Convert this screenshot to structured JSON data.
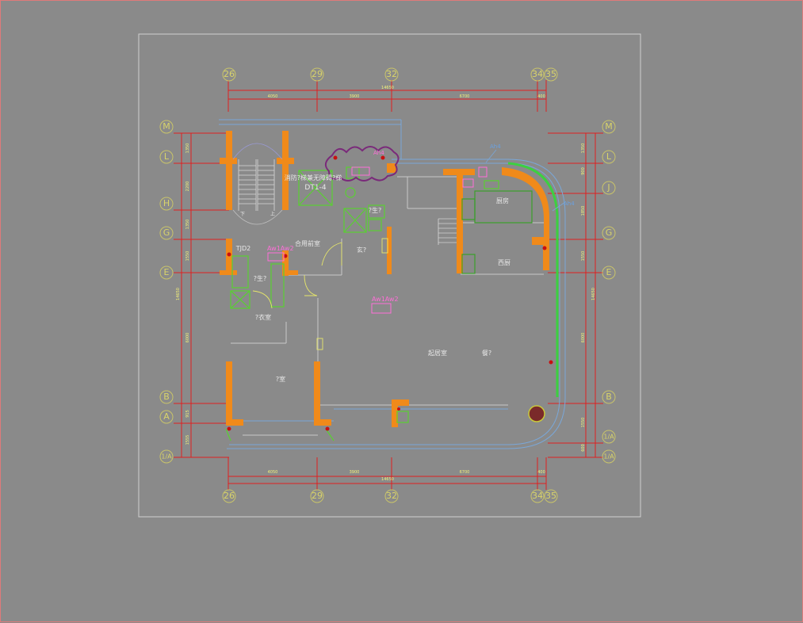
{
  "grid": {
    "columns": [
      "26",
      "29",
      "32",
      "34",
      "35"
    ],
    "rows_left": [
      "M",
      "L",
      "H",
      "G",
      "E",
      "B",
      "A",
      "1/A"
    ],
    "rows_right": [
      "M",
      "L",
      "J",
      "G",
      "E",
      "B",
      "1/A",
      "1/A"
    ]
  },
  "dimensions": {
    "top": [
      "4050",
      "3900",
      "6700",
      "400"
    ],
    "top_total": "14650",
    "bottom": [
      "4050",
      "3900",
      "6700",
      "400"
    ],
    "bottom_total": "14650",
    "left": [
      "1350",
      "2200",
      "1350",
      "1550",
      "6000",
      "915",
      "1555"
    ],
    "left_total": "14650",
    "right": [
      "1350",
      "900",
      "1850",
      "1550",
      "6000",
      "1550",
      "600"
    ],
    "right_total": "14650"
  },
  "rooms": {
    "shaft": "消防?梯兼无障碍?梯",
    "dt": "DT1-4",
    "shared_vestibule": "合用前室",
    "tjd2": "TJD2",
    "entry": "玄?",
    "wc_small": "?生?",
    "bathroom": "?生?",
    "walkin": "?衣室",
    "bedroom": "?室",
    "living": "起居室",
    "dining": "餐?",
    "kitchen": "厨房",
    "west_kitchen": "西厨",
    "stair_down": "下",
    "stair_up": "上"
  },
  "tags": {
    "awaw2": "Aw1Aw2",
    "ah4": "Ah4"
  },
  "colors": {
    "background": "#8a8a8a",
    "structural_wall": "#f08a1a",
    "dimension_line": "#e02020",
    "grid_bubble": "#c9c46a",
    "fixture": "#5ad032",
    "equipment_tag": "#ff6fd8",
    "outer_wall": "#7aa7d8"
  }
}
